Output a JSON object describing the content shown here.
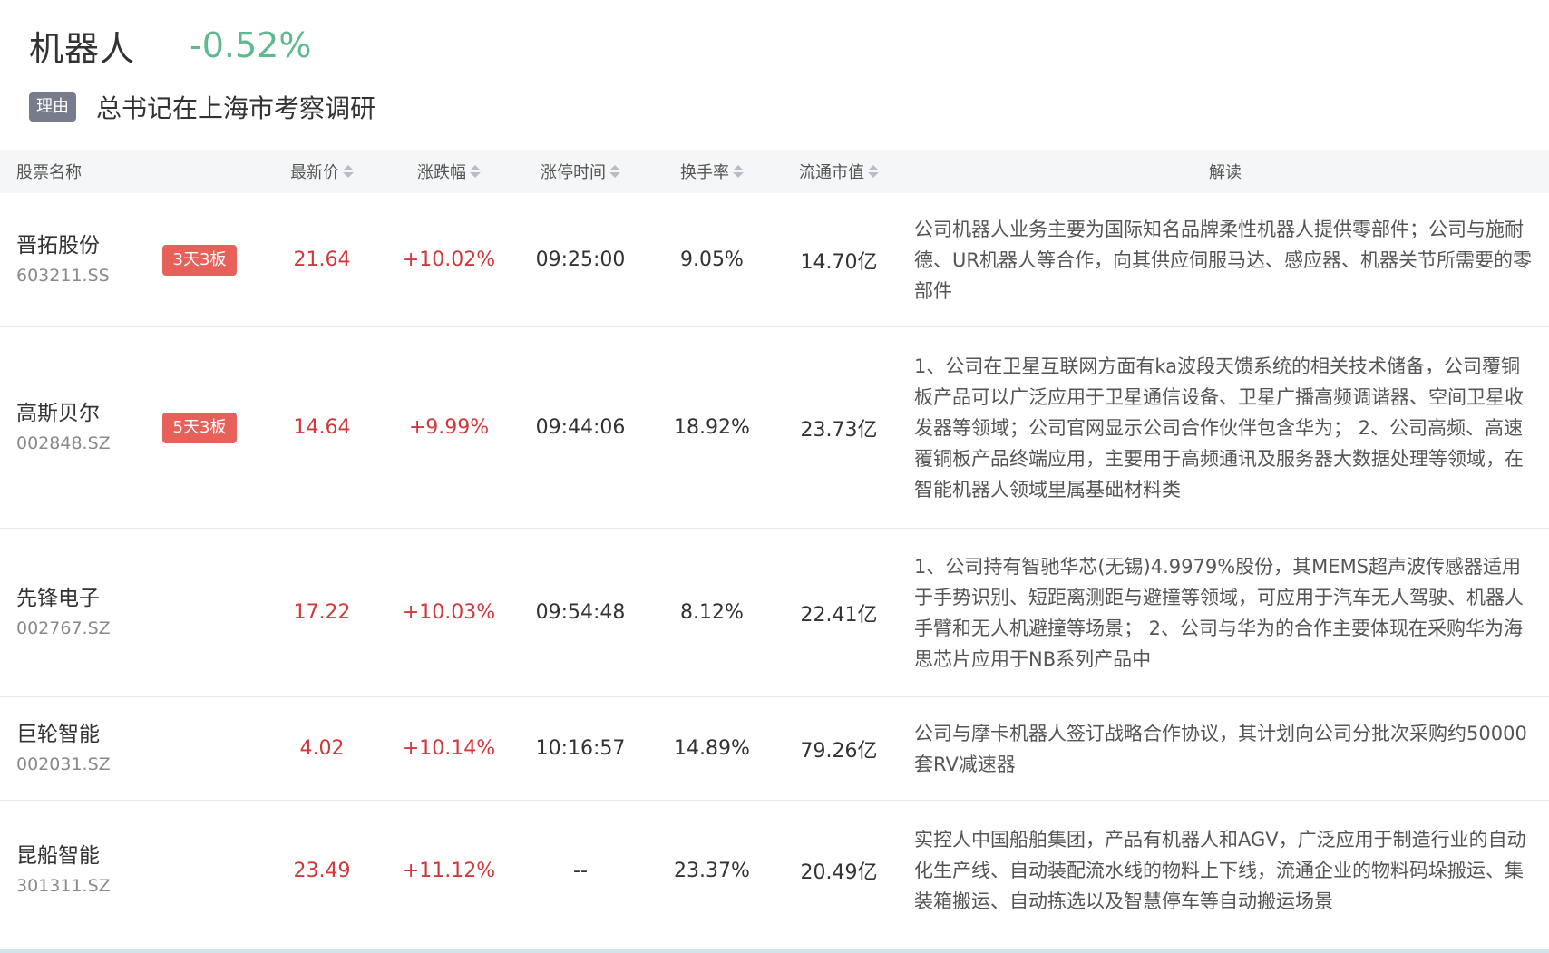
{
  "sector": {
    "name": "机器人",
    "change": "-0.52%"
  },
  "reason": {
    "badge": "理由",
    "text": "总书记在上海市考察调研"
  },
  "columns": {
    "name": "股票名称",
    "price": "最新价",
    "change": "涨跌幅",
    "limit_time": "涨停时间",
    "turnover": "换手率",
    "float_cap": "流通市值",
    "desc": "解读"
  },
  "colors": {
    "up": "#d0393c",
    "down": "#5fb98f",
    "tag": "#e8605a",
    "badge": "#777c8c"
  },
  "rows": [
    {
      "name": "晋拓股份",
      "code": "603211.SS",
      "tag": "3天3板",
      "price": "21.64",
      "change": "+10.02%",
      "limit_time": "09:25:00",
      "turnover": "9.05%",
      "float_cap": "14.70亿",
      "desc": "公司机器人业务主要为国际知名品牌柔性机器人提供零部件；公司与施耐德、UR机器人等合作，向其供应伺服马达、感应器、机器关节所需要的零部件"
    },
    {
      "name": "高斯贝尔",
      "code": "002848.SZ",
      "tag": "5天3板",
      "price": "14.64",
      "change": "+9.99%",
      "limit_time": "09:44:06",
      "turnover": "18.92%",
      "float_cap": "23.73亿",
      "desc": "1、公司在卫星互联网方面有ka波段天馈系统的相关技术储备，公司覆铜板产品可以广泛应用于卫星通信设备、卫星广播高频调谐器、空间卫星收发器等领域；公司官网显示公司合作伙伴包含华为； 2、公司高频、高速覆铜板产品终端应用，主要用于高频通讯及服务器大数据处理等领域，在智能机器人领域里属基础材料类"
    },
    {
      "name": "先锋电子",
      "code": "002767.SZ",
      "tag": "",
      "price": "17.22",
      "change": "+10.03%",
      "limit_time": "09:54:48",
      "turnover": "8.12%",
      "float_cap": "22.41亿",
      "desc": "1、公司持有智驰华芯(无锡)4.9979%股份，其MEMS超声波传感器适用于手势识别、短距离测距与避撞等领域，可应用于汽车无人驾驶、机器人手臂和无人机避撞等场景； 2、公司与华为的合作主要体现在采购华为海思芯片应用于NB系列产品中"
    },
    {
      "name": "巨轮智能",
      "code": "002031.SZ",
      "tag": "",
      "price": "4.02",
      "change": "+10.14%",
      "limit_time": "10:16:57",
      "turnover": "14.89%",
      "float_cap": "79.26亿",
      "desc": "公司与摩卡机器人签订战略合作协议，其计划向公司分批次采购约50000套RV减速器"
    },
    {
      "name": "昆船智能",
      "code": "301311.SZ",
      "tag": "",
      "price": "23.49",
      "change": "+11.12%",
      "limit_time": "--",
      "turnover": "23.37%",
      "float_cap": "20.49亿",
      "desc": "实控人中国船舶集团，产品有机器人和AGV，广泛应用于制造行业的自动化生产线、自动装配流水线的物料上下线，流通企业的物料码垛搬运、集装箱搬运、自动拣选以及智慧停车等自动搬运场景"
    }
  ]
}
